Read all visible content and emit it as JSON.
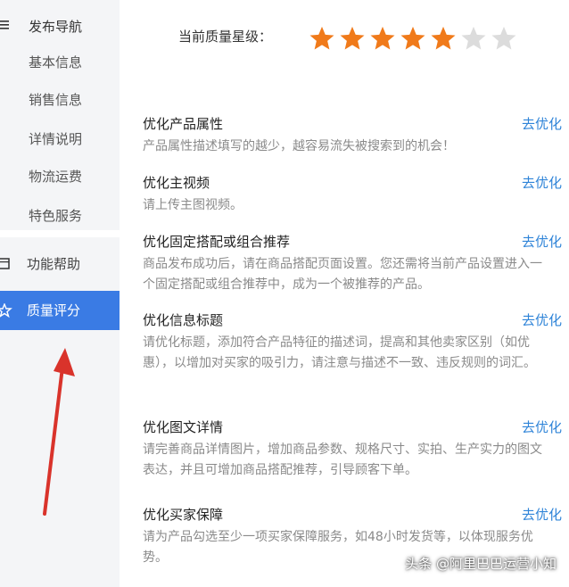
{
  "sidebar": {
    "group_label": "发布导航",
    "sub_items": [
      "基本信息",
      "销售信息",
      "详情说明",
      "物流运费",
      "特色服务"
    ],
    "help_label": "功能帮助",
    "active_label": "质量评分"
  },
  "header": {
    "rating_label": "当前质量星级：",
    "rating": 5,
    "rating_max": 7,
    "star_color": "#f07a1a",
    "star_empty_color": "#dcdcdc"
  },
  "tasks": [
    {
      "title": "优化产品属性",
      "action": "去优化",
      "desc": "产品属性描述填写的越少，越容易流失被搜索到的机会！"
    },
    {
      "title": "优化主视频",
      "action": "去优化",
      "desc": "请上传主图视频。"
    },
    {
      "title": "优化固定搭配或组合推荐",
      "action": "去优化",
      "desc": "商品发布成功后，请在商品搭配页面设置。您还需将当前产品设置进入一个固定搭配或组合推荐中，成为一个被推荐的产品。"
    },
    {
      "title": "优化信息标题",
      "action": "去优化",
      "desc": "请优化标题，添加符合产品特征的描述词，提高和其他卖家区别（如优惠），以增加对买家的吸引力，请注意与描述不一致、违反规则的词汇。"
    },
    {
      "title": "优化图文详情",
      "action": "去优化",
      "desc": "请完善商品详情图片，增加商品参数、规格尺寸、实拍、生产实力的图文表达，并且可增加商品搭配推荐，引导顾客下单。"
    },
    {
      "title": "优化买家保障",
      "action": "去优化",
      "desc": "请为产品勾选至少一项买家保障服务，如48小时发货等，以体现服务优势。"
    }
  ],
  "watermark": "头条 @阿里巴巴运营小知",
  "colors": {
    "active_bg": "#3a7be4",
    "link": "#2f84d8",
    "arrow": "#d9332b"
  }
}
